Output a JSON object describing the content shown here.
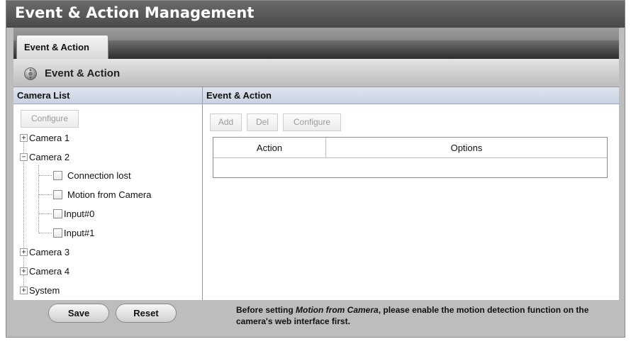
{
  "app": {
    "title": "Event & Action Management"
  },
  "tabs": [
    {
      "label": "Event & Action"
    }
  ],
  "panel": {
    "title": "Event & Action",
    "icon": "gear-icon"
  },
  "camera_list": {
    "header": "Camera List",
    "configure_label": "Configure",
    "tree": {
      "camera1": {
        "label": "Camera 1",
        "expanded": false
      },
      "camera2": {
        "label": "Camera 2",
        "expanded": true,
        "events": [
          {
            "label": "Connection lost",
            "checked": false
          },
          {
            "label": "Motion from Camera",
            "checked": false
          },
          {
            "label": "Input#0",
            "checked": false
          },
          {
            "label": "Input#1",
            "checked": false
          }
        ]
      },
      "camera3": {
        "label": "Camera 3",
        "expanded": false
      },
      "camera4": {
        "label": "Camera 4",
        "expanded": false
      },
      "system": {
        "label": "System",
        "expanded": false
      }
    }
  },
  "event_action": {
    "header": "Event & Action",
    "toolbar": {
      "add_label": "Add",
      "del_label": "Del",
      "configure_label": "Configure"
    },
    "table": {
      "columns": [
        "Action",
        "Options"
      ],
      "rows": []
    }
  },
  "footer": {
    "save_label": "Save",
    "reset_label": "Reset",
    "note_prefix": "Before setting ",
    "note_emphasis": "Motion from Camera",
    "note_suffix": ", please enable the motion detection function on the camera's web interface first."
  },
  "colors": {
    "title_bar": "#555555",
    "pane_header": "#c9d2e2",
    "disabled_text": "#9a9a9a"
  }
}
